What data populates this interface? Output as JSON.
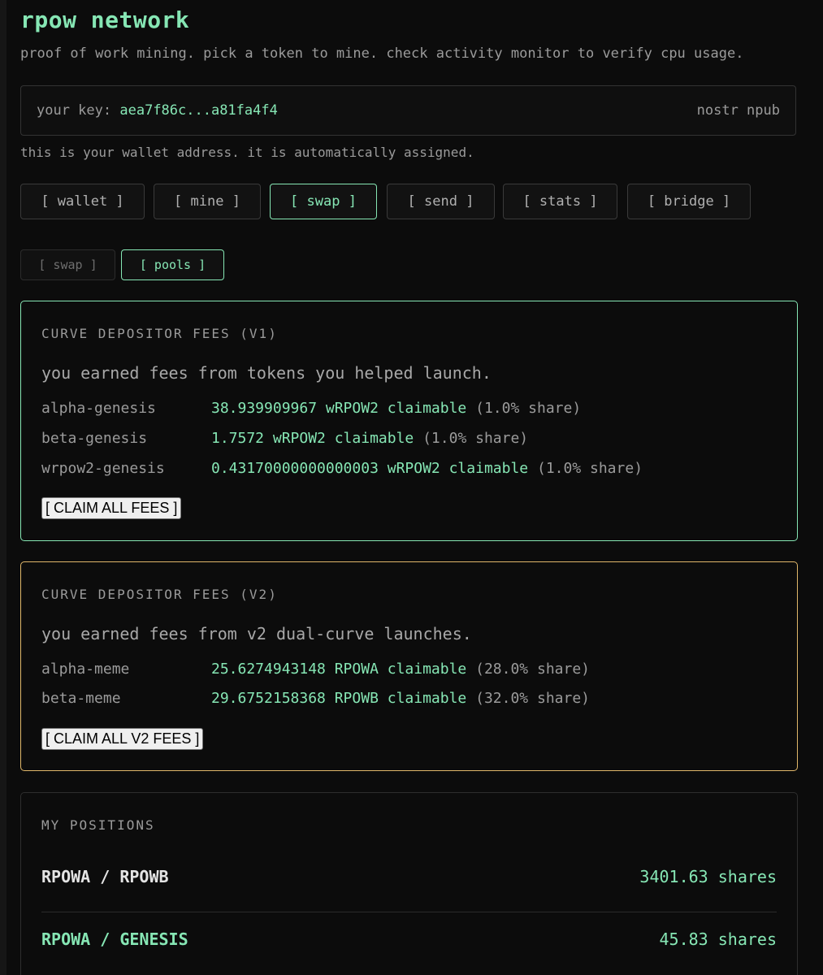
{
  "app": {
    "title": "rpow network",
    "subtitle": "proof of work mining. pick a token to mine. check activity monitor to verify cpu usage."
  },
  "key": {
    "label": "your key:",
    "value": "aea7f86c...a81fa4f4",
    "type": "nostr npub",
    "note": "this is your wallet address. it is automatically assigned."
  },
  "tabs": [
    {
      "label": "[ wallet ]",
      "active": false
    },
    {
      "label": "[ mine ]",
      "active": false
    },
    {
      "label": "[ swap ]",
      "active": true
    },
    {
      "label": "[ send ]",
      "active": false
    },
    {
      "label": "[ stats ]",
      "active": false
    },
    {
      "label": "[ bridge ]",
      "active": false
    }
  ],
  "subtabs": [
    {
      "label": "[ swap ]",
      "active": false
    },
    {
      "label": "[ pools ]",
      "active": true
    }
  ],
  "colors": {
    "accent": "#86e6b4",
    "v2_border": "#e0b76a",
    "background": "#0c0c0c"
  },
  "fees_v1": {
    "heading": "CURVE DEPOSITOR FEES (V1)",
    "description": "you earned fees from tokens you helped launch.",
    "rows": [
      {
        "name": "alpha-genesis",
        "amount": "38.939909967 wRPOW2 claimable",
        "share": "(1.0% share)"
      },
      {
        "name": "beta-genesis",
        "amount": "1.7572 wRPOW2 claimable",
        "share": "(1.0% share)"
      },
      {
        "name": "wrpow2-genesis",
        "amount": "0.43170000000000003 wRPOW2 claimable",
        "share": "(1.0% share)"
      }
    ],
    "button_label": "[ CLAIM ALL FEES ]"
  },
  "fees_v2": {
    "heading": "CURVE DEPOSITOR FEES (V2)",
    "description": "you earned fees from v2 dual-curve launches.",
    "rows": [
      {
        "name": "alpha-meme",
        "amount": "25.6274943148 RPOWA claimable",
        "share": "(28.0% share)"
      },
      {
        "name": "beta-meme",
        "amount": "29.6752158368 RPOWB claimable",
        "share": "(32.0% share)"
      }
    ],
    "button_label": "[ CLAIM ALL V2 FEES ]"
  },
  "positions": {
    "heading": "MY POSITIONS",
    "rows": [
      {
        "pair": "RPOWA / RPOWB",
        "shares": "3401.63 shares",
        "pair_color": "#e4e4e4"
      },
      {
        "pair": "RPOWA / GENESIS",
        "shares": "45.83 shares",
        "pair_color": "#86e6b4"
      }
    ]
  }
}
